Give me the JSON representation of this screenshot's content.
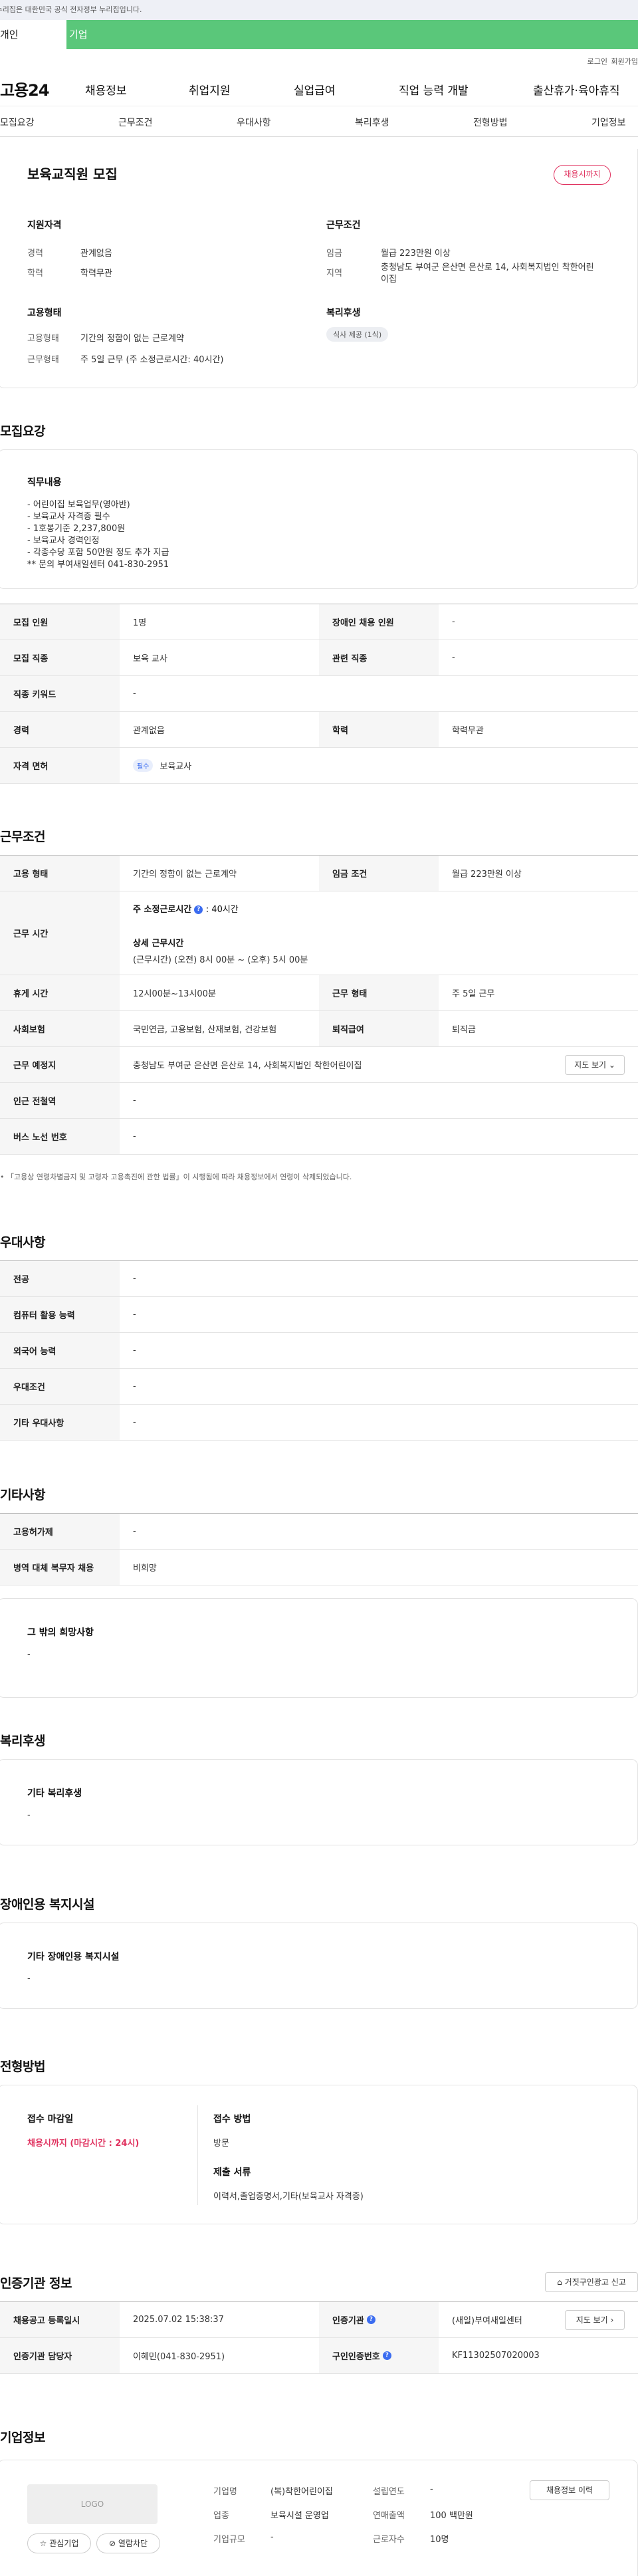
{
  "notice": "이 누리집은 대한민국 공식 전자정부 누리집입니다.",
  "tabs": [
    "개인",
    "기업"
  ],
  "util": {
    "login": "로그인",
    "signup": "회원가입"
  },
  "logo": "고용24",
  "gnb": [
    "채용정보",
    "취업지원",
    "실업급여",
    "직업 능력 개발",
    "출산휴가·육아휴직"
  ],
  "subnav": [
    "모집요강",
    "근무조건",
    "우대사항",
    "복리후생",
    "전형방법",
    "기업정보"
  ],
  "summary": {
    "title": "보육교직원 모집",
    "status": "채용시까지",
    "qualify_title": "지원자격",
    "career_label": "경력",
    "career_value": "관계없음",
    "edu_label": "학력",
    "edu_value": "학력무관",
    "emp_title": "고용형태",
    "emp_label": "고용형태",
    "emp_value": "기간의 정함이 없는 근로계약",
    "work_label": "근무형태",
    "work_value": "주 5일 근무 (주 소정근로시간: 40시간)",
    "cond_title": "근무조건",
    "wage_label": "임금",
    "wage_value": "월급 223만원 이상",
    "region_label": "지역",
    "region_value": "충청남도 부여군 은산면 은산로 14, 사회복지법인 착한어린이집",
    "welfare_title": "복리후생",
    "welfare_chip": "식사 제공 (1식)"
  },
  "recruit": {
    "title": "모집요강",
    "duty_title": "직무내용",
    "duty_lines": [
      "- 어린이집 보육업무(영아반)",
      "- 보육교사 자격증 필수",
      "- 1호봉기준 2,237,800원",
      "- 보육교사 경력인정",
      "- 각종수당 포함 50만원 정도 추가 지급",
      "** 문의 부여새일센터 041-830-2951"
    ],
    "rows": [
      {
        "k1": "모집 인원",
        "v1": "1명",
        "k2": "장애인 채용 인원",
        "v2": "-"
      },
      {
        "k1": "모집 직종",
        "v1": "보육 교사",
        "k2": "관련 직종",
        "v2": "-"
      },
      {
        "k1": "직종 키워드",
        "v1": "-"
      },
      {
        "k1": "경력",
        "v1": "관계없음",
        "k2": "학력",
        "v2": "학력무관"
      },
      {
        "k1": "자격 면허",
        "tag": "필수",
        "v1": "보육교사"
      }
    ]
  },
  "work": {
    "title": "근무조건",
    "emp_k": "고용 형태",
    "emp_v": "기간의 정함이 없는 근로계약",
    "wage_k": "임금 조건",
    "wage_v": "월급 223만원 이상",
    "time_k": "근무 시간",
    "time_a": "주 소정근로시간",
    "time_a_v": ": 40시간",
    "time_b": "상세 근무시간",
    "time_b_v": "(근무시간) (오전) 8시 00분 ~ (오후) 5시 00분",
    "break_k": "휴게 시간",
    "break_v": "12시00분~13시00분",
    "form_k": "근무 형태",
    "form_v": "주 5일 근무",
    "ins_k": "사회보험",
    "ins_v": "국민연금, 고용보험, 산재보험, 건강보험",
    "ret_k": "퇴직급여",
    "ret_v": "퇴직금",
    "place_k": "근무 예정지",
    "place_v": "충청남도 부여군 은산면 은산로 14, 사회복지법인 착한어린이집",
    "map_btn": "지도 보기",
    "station_k": "인근 전철역",
    "station_v": "-",
    "bus_k": "버스 노선 번호",
    "bus_v": "-",
    "note": "• 「고용상 연령차별금지 및 고령자 고용촉진에 관한 법률」이 시행됨에 따라 채용정보에서 연령이 삭제되었습니다."
  },
  "pref": {
    "title": "우대사항",
    "rows": [
      {
        "k": "전공",
        "v": "-"
      },
      {
        "k": "컴퓨터 활용 능력",
        "v": "-"
      },
      {
        "k": "외국어 능력",
        "v": "-"
      },
      {
        "k": "우대조건",
        "v": "-"
      },
      {
        "k": "기타 우대사항",
        "v": "-"
      }
    ]
  },
  "etc": {
    "title": "기타사항",
    "rows": [
      {
        "k": "고용허가제",
        "v": "-"
      },
      {
        "k": "병역 대체 복무자 채용",
        "v": "비희망"
      }
    ],
    "hope_title": "그 밖의 희망사항",
    "hope_v": "-"
  },
  "welfare": {
    "title": "복리후생",
    "sub": "기타 복리후생",
    "v": "-"
  },
  "disabled": {
    "title": "장애인용 복지시설",
    "sub": "기타 장애인용 복지시설",
    "v": "-"
  },
  "select": {
    "title": "전형방법",
    "deadline_k": "접수 마감일",
    "deadline_v": "채용시까지 (마감시간 : 24시)",
    "method_k": "접수 방법",
    "method_v": "방문",
    "docs_k": "제출 서류",
    "docs_v": "이력서,졸업증명서,기타(보육교사 자격증)"
  },
  "agency": {
    "title": "인증기관 정보",
    "report_btn": "거짓구인광고 신고",
    "reg_k": "채용공고 등록일시",
    "reg_v": "2025.07.02 15:38:37",
    "org_k": "인증기관",
    "org_v": "(새일)부여새일센터",
    "map_btn": "지도 보기",
    "mgr_k": "인증기관 담당자",
    "mgr_v": "이혜민(041-830-2951)",
    "num_k": "구인인증번호",
    "num_v": "KF11302507020003"
  },
  "company": {
    "title": "기업정보",
    "logo": "LOGO",
    "fav_btn": "관심기업",
    "block_btn": "열람차단",
    "history_btn": "채용정보 이력",
    "name_k": "기업명",
    "name_v": "(복)착한어린이집",
    "year_k": "설립연도",
    "year_v": "-",
    "ind_k": "업종",
    "ind_v": "보육시설 운영업",
    "sales_k": "연매출액",
    "sales_v": "100 백만원",
    "size_k": "기업규모",
    "size_v": "-",
    "emp_k": "근로자수",
    "emp_v": "10명"
  },
  "colors": {
    "green": "#5ac77a",
    "red": "#e0325f",
    "blue": "#3b6cf0"
  }
}
